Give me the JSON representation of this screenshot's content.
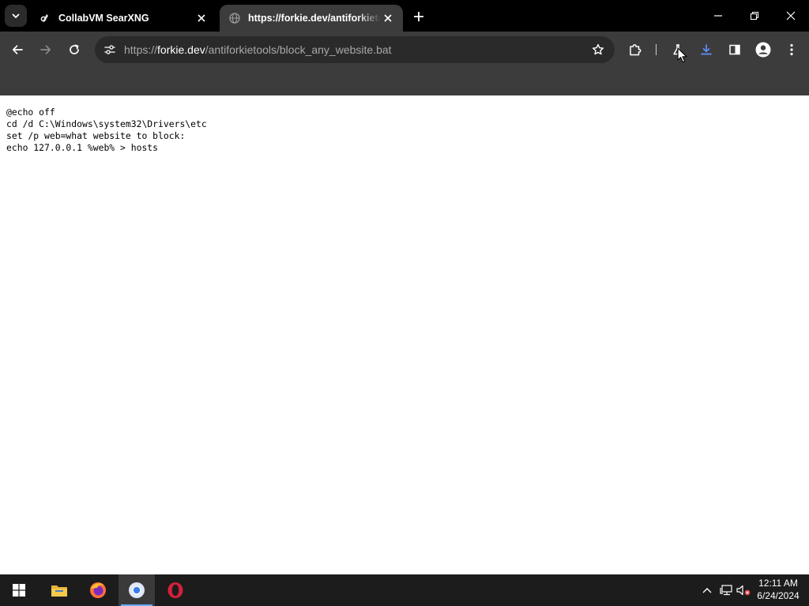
{
  "browser": {
    "tabs": [
      {
        "title": "CollabVM SearXNG",
        "active": false
      },
      {
        "title": "https://forkie.dev/antiforkietools/block_any_website.bat",
        "active": true
      }
    ],
    "address_bar": {
      "scheme": "https://",
      "host": "forkie.dev",
      "path": "/antiforkietools/block_any_website.bat"
    }
  },
  "page": {
    "lines": [
      "@echo off",
      "cd /d C:\\Windows\\system32\\Drivers\\etc",
      "set /p web=what website to block:",
      "echo 127.0.0.1 %web% > hosts"
    ]
  },
  "taskbar": {
    "apps": [
      "Start",
      "File Explorer",
      "Firefox",
      "Chrome",
      "Opera"
    ],
    "active_app": "Chrome",
    "clock": {
      "time": "12:11 AM",
      "date": "6/24/2024"
    }
  },
  "colors": {
    "tabstrip_bg": "#000000",
    "toolbar_bg": "#3c3c3c",
    "taskbar_bg": "#1c1c1c",
    "accent": "#6aa9ff"
  }
}
